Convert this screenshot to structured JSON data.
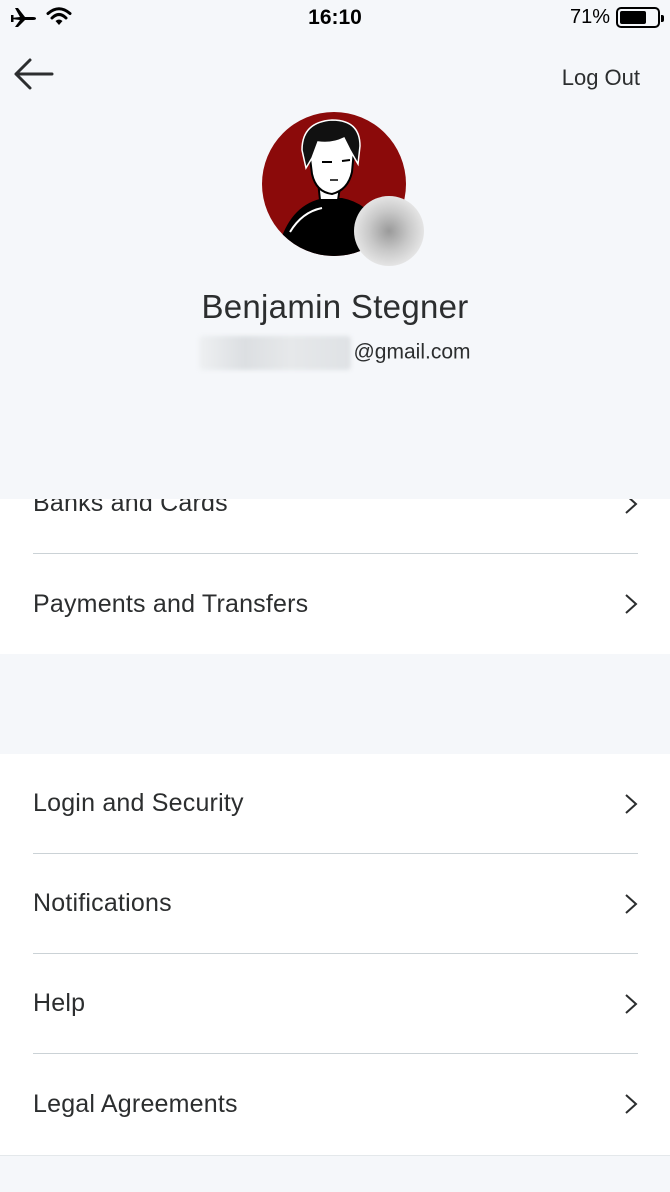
{
  "status_bar": {
    "time": "16:10",
    "battery_percent": "71%",
    "battery_level": 0.71,
    "icons": [
      "airplane-icon",
      "wifi-icon",
      "battery-icon"
    ]
  },
  "header": {
    "logout_label": "Log Out",
    "user_name": "Benjamin Stegner",
    "email_suffix": "@gmail.com",
    "avatar_bg": "#8b0a0a",
    "background": "#f5f7fa"
  },
  "sections": [
    {
      "items": [
        {
          "label": "Banks and Cards"
        },
        {
          "label": "Payments and Transfers"
        }
      ]
    },
    {
      "items": [
        {
          "label": "Login and Security"
        },
        {
          "label": "Notifications"
        },
        {
          "label": "Help"
        },
        {
          "label": "Legal Agreements"
        }
      ]
    }
  ]
}
